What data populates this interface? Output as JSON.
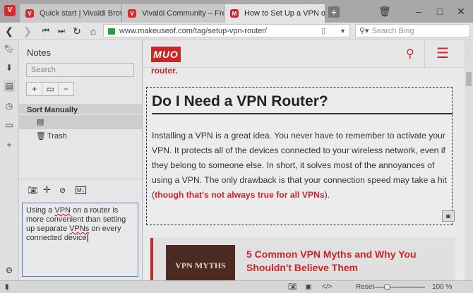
{
  "tabs": [
    {
      "title": "Quick start | Vivaldi Browser"
    },
    {
      "title": "Vivaldi Community – Free we"
    },
    {
      "title": "How to Set Up a VPN on You"
    }
  ],
  "address": {
    "url": "www.makeuseof.com/tag/setup-vpn-router/",
    "search_placeholder": "Search Bing"
  },
  "notes": {
    "title": "Notes",
    "search_placeholder": "Search",
    "sort_label": "Sort Manually",
    "trash_label": "Trash",
    "media_label": "M↓",
    "editor_text": [
      "Using a ",
      "VPN",
      " on a router is more convenient than setting up separate ",
      "VPNs",
      " on every connected device"
    ]
  },
  "page": {
    "logo": "MUO",
    "router_tail": "router.",
    "heading": "Do I Need a VPN Router?",
    "body": "Installing a VPN is a great idea. You never have to remember to activate your VPN. It protects all of the devices connected to your wireless network, even if they belong to someone else. In short, it solves most of the annoyances of using a VPN. The only drawback is that your connection speed may take a hit (",
    "body_link": "though that's not always true for all VPNs",
    "body_end": ").",
    "related_title": "5 Common VPN Myths and Why You Shouldn't Believe Them",
    "related_img_text": "VPN MYTHS"
  },
  "status": {
    "reset_label": "Reset",
    "zoom": "100 %"
  },
  "colors": {
    "accent": "#c8262a",
    "focus": "#4a82c4"
  }
}
